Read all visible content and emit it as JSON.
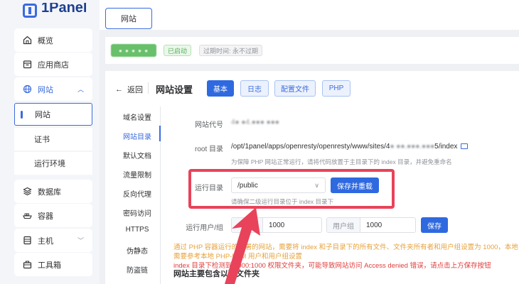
{
  "app": {
    "logo_text": "1Panel"
  },
  "sidebar": {
    "items": [
      {
        "label": "概览",
        "icon": "home-icon"
      },
      {
        "label": "应用商店",
        "icon": "store-icon"
      },
      {
        "label": "网站",
        "icon": "globe-icon",
        "expanded": true
      },
      {
        "label": "数据库",
        "icon": "database-icon"
      },
      {
        "label": "容器",
        "icon": "container-icon"
      },
      {
        "label": "主机",
        "icon": "host-icon"
      },
      {
        "label": "工具箱",
        "icon": "toolbox-icon"
      }
    ],
    "website_sub": [
      "网站",
      "证书",
      "运行环境"
    ]
  },
  "top_tab": {
    "label": "网站"
  },
  "status": {
    "running": "已启动",
    "expire": "过期时间: 永不过期"
  },
  "header": {
    "back": "返回",
    "title": "网站设置",
    "tabs": [
      "基本",
      "日志",
      "配置文件",
      "PHP"
    ]
  },
  "menu": [
    "域名设置",
    "网站目录",
    "默认文档",
    "流量限制",
    "反向代理",
    "密码访问",
    "HTTPS",
    "伪静态",
    "防盗链"
  ],
  "form": {
    "code_label": "网站代号",
    "root_label": "root 目录",
    "root_prefix": "/opt/1panel/apps/openresty/openresty/www/sites/4",
    "root_suffix": "5/index",
    "root_hint": "为保障 PHP 网站正常运行，请将代码放置于主目录下的 index 目录，并避免重命名",
    "run_dir_label": "运行目录",
    "run_dir_value": "/public",
    "save_reload": "保存并重载",
    "run_dir_hint": "请确保二级运行目录位于 index 目录下",
    "user_label": "运行用户/组",
    "user_value": "1000",
    "group_prefix": "用户组",
    "group_value": "1000",
    "save": "保存"
  },
  "notes": {
    "warn1": "通过 PHP 容器运行的部署的网站，需要将 index 和子目录下的所有文件、文件夹所有者和用户组设置为 1000，本地",
    "warn2": "需要参考本地 PHP-FPM 用户和用户组设置",
    "err": "index 目录下检测到 1000:1000 权限文件夹，可能导致网站访问 Access denied 错误，请点击上方保存按钮",
    "section_title": "网站主要包含以下文件夹"
  },
  "colors": {
    "accent": "#2f69e0",
    "highlight": "#e8435a",
    "success": "#59b05c",
    "warning": "#e6a23c",
    "error": "#e03c3c"
  }
}
